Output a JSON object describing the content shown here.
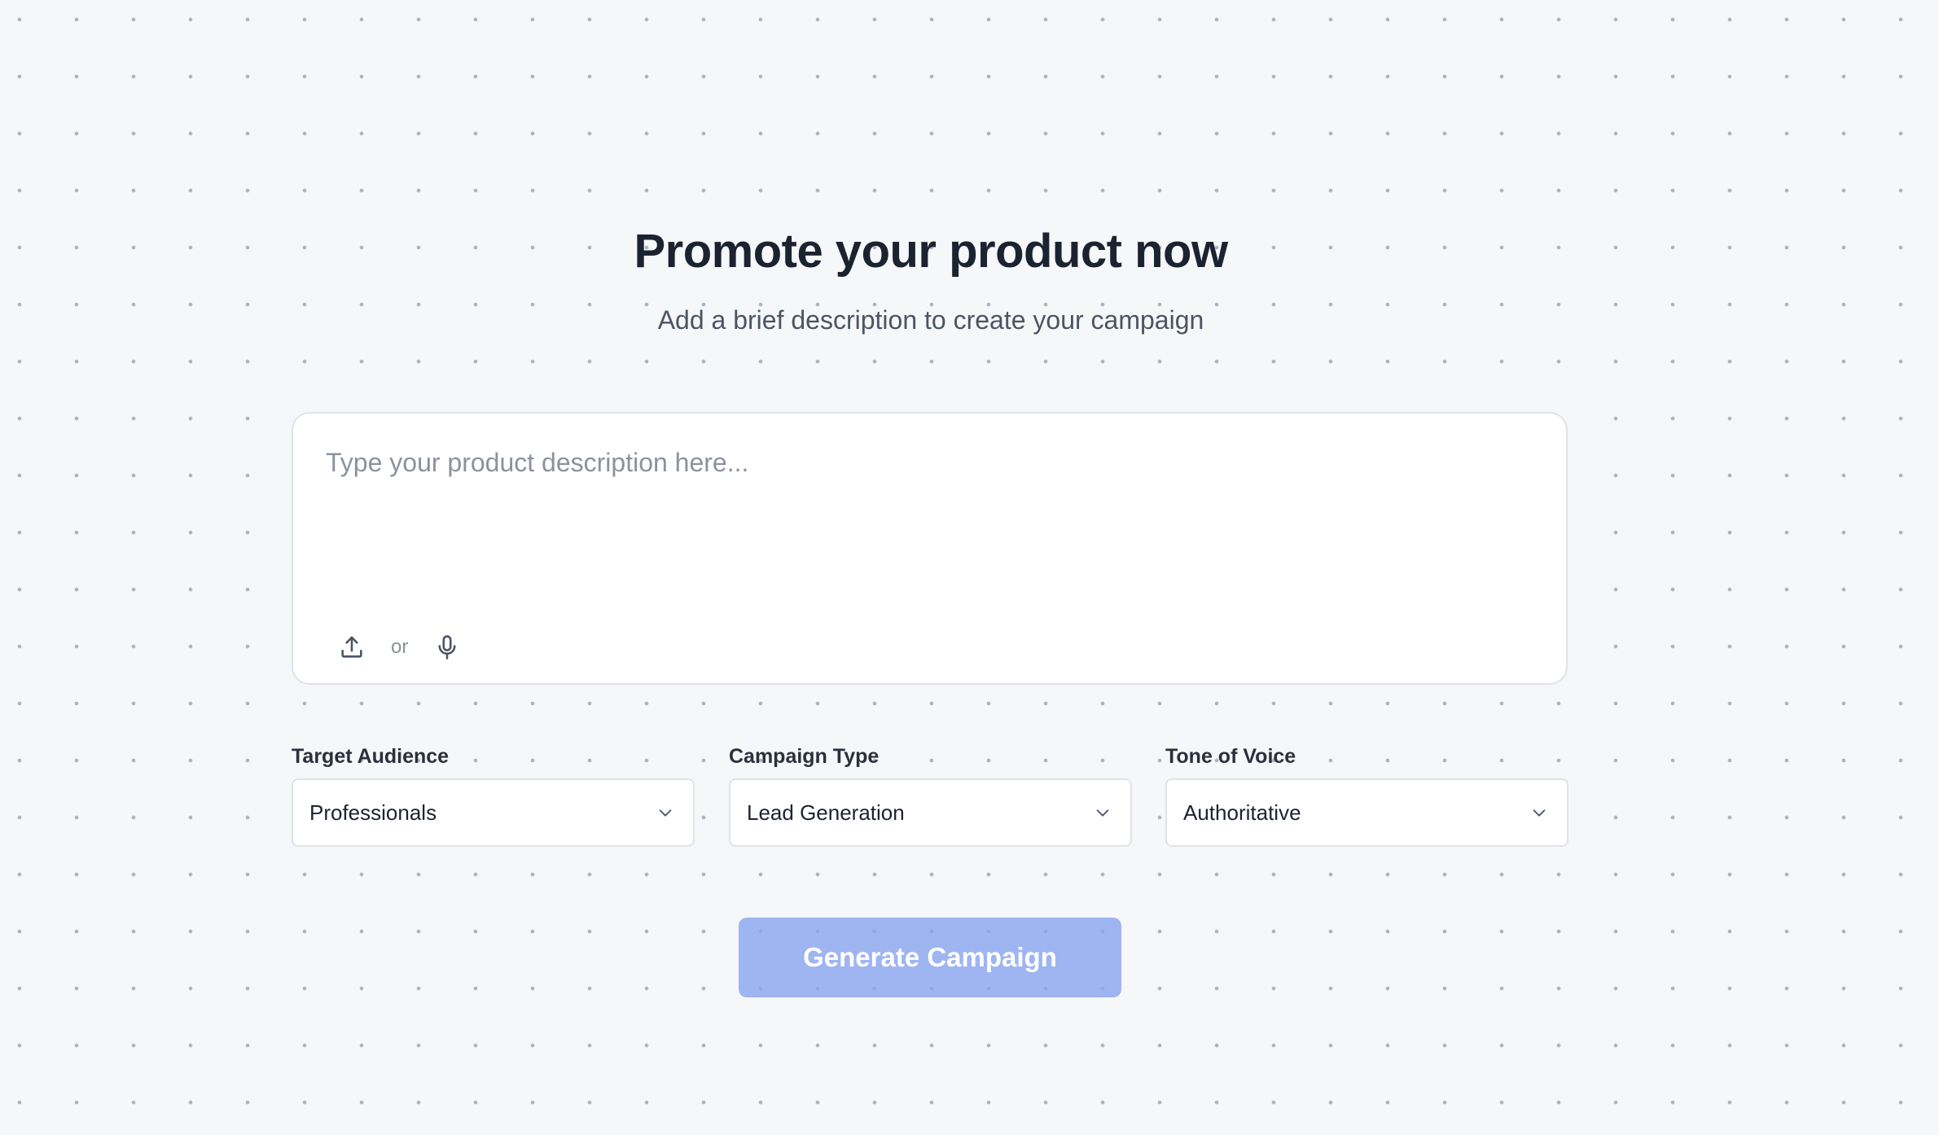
{
  "header": {
    "title": "Promote your product now",
    "subtitle": "Add a brief description to create your campaign"
  },
  "description": {
    "placeholder": "Type your product description here...",
    "value": "",
    "upload_icon": "upload-icon",
    "separator_text": "or",
    "mic_icon": "microphone-icon"
  },
  "selects": {
    "target_audience": {
      "label": "Target Audience",
      "value": "Professionals"
    },
    "campaign_type": {
      "label": "Campaign Type",
      "value": "Lead Generation"
    },
    "tone_of_voice": {
      "label": "Tone of Voice",
      "value": "Authoritative"
    }
  },
  "actions": {
    "generate_label": "Generate Campaign"
  },
  "colors": {
    "background": "#f6f7f9",
    "primary_button": "#a3b7f1",
    "title_text": "#1c2330",
    "border": "#dfe2e7"
  }
}
